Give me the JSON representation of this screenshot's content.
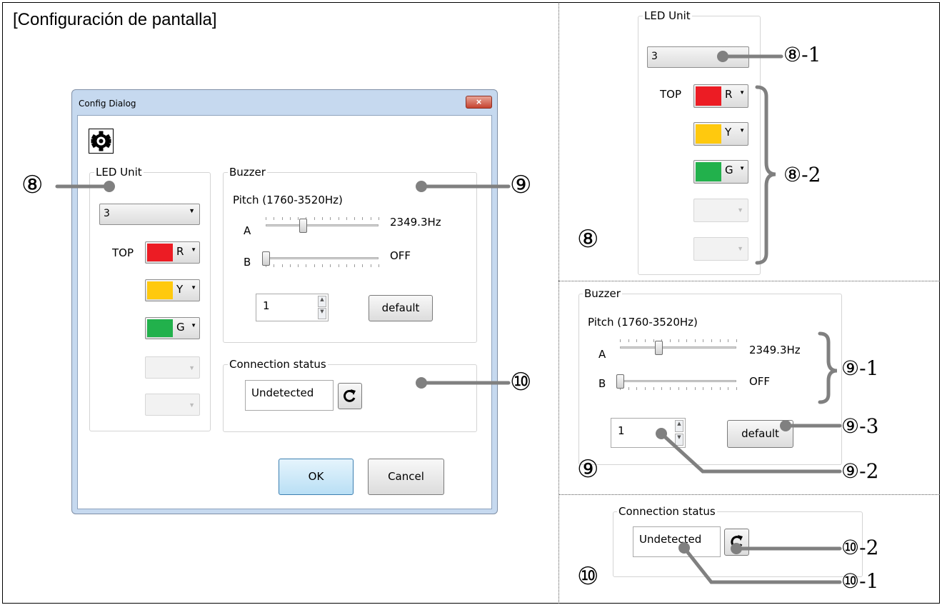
{
  "page_title": "[Configuración de pantalla]",
  "dialog": {
    "title": "Config Dialog",
    "close_label": "×",
    "led": {
      "group_label": "LED Unit",
      "count_value": "3",
      "top_label": "TOP",
      "colors": [
        {
          "letter": "R",
          "color": "#ec1c24"
        },
        {
          "letter": "Y",
          "color": "#ffc90e"
        },
        {
          "letter": "G",
          "color": "#22b14c"
        }
      ]
    },
    "buzzer": {
      "group_label": "Buzzer",
      "pitch_label": "Pitch (1760-3520Hz)",
      "a_label": "A",
      "a_value": "2349.3Hz",
      "a_level": 0.33,
      "b_label": "B",
      "b_value": "OFF",
      "b_level": 0.0,
      "count_value": "1",
      "default_label": "default"
    },
    "connection": {
      "group_label": "Connection status",
      "status_value": "Undetected"
    },
    "ok_label": "OK",
    "cancel_label": "Cancel"
  },
  "callouts": {
    "c8": "⑧",
    "c9": "⑨",
    "c10": "⑩",
    "c8_1": "⑧-1",
    "c8_2": "⑧-2",
    "c9_1": "⑨-1",
    "c9_2": "⑨-2",
    "c9_3": "⑨-3",
    "c10_1": "⑩-1",
    "c10_2": "⑩-2"
  }
}
